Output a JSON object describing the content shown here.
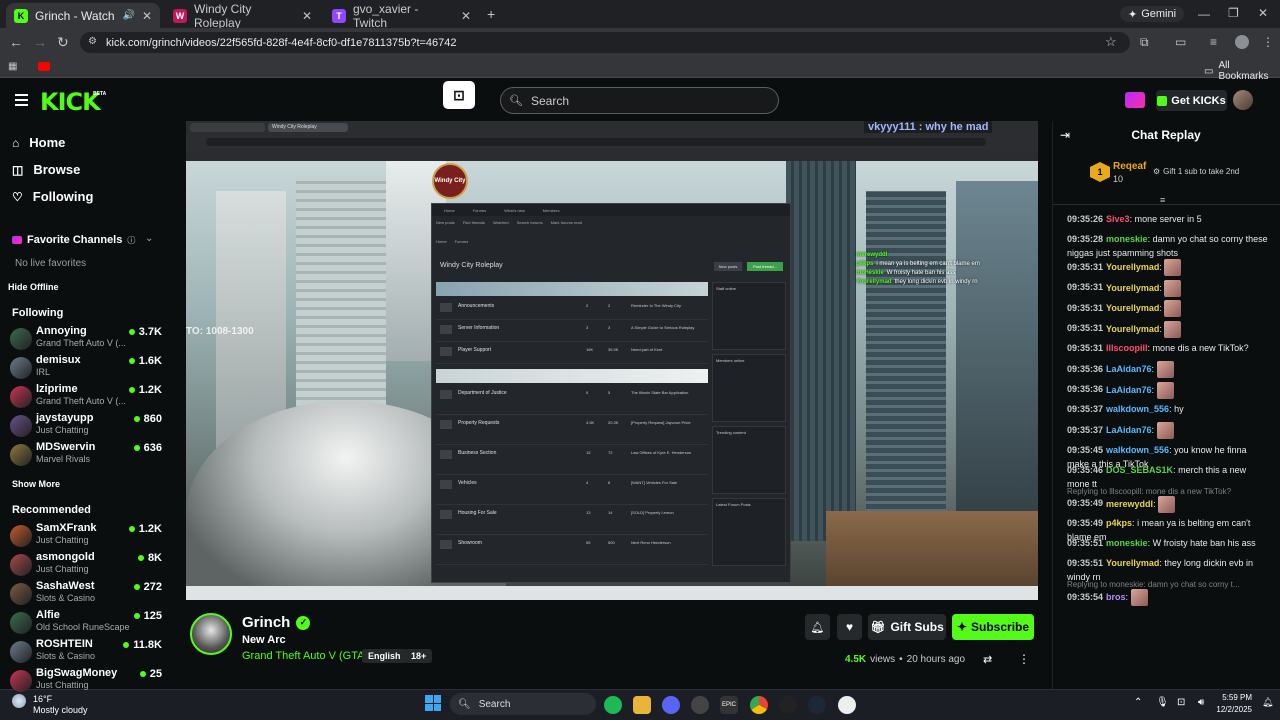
{
  "browser": {
    "tabs": [
      {
        "title": "Grinch - Watch the VOD on",
        "active": true
      },
      {
        "title": "Windy City Roleplay",
        "active": false
      },
      {
        "title": "gvo_xavier - Twitch",
        "active": false
      }
    ],
    "gemini_label": "Gemini",
    "url": "kick.com/grinch/videos/22f565fd-828f-4e4f-8cf0-df1e7811375b?t=46742",
    "all_bookmarks": "All Bookmarks"
  },
  "header": {
    "logo": "KICK",
    "logo_beta": "BETA",
    "search_placeholder": "Search",
    "get_kicks": "Get KICKs"
  },
  "sidebar": {
    "nav": [
      {
        "label": "Home",
        "icon": "home-icon"
      },
      {
        "label": "Browse",
        "icon": "compass-icon"
      },
      {
        "label": "Following",
        "icon": "heart-icon"
      }
    ],
    "favorite_title": "Favorite Channels",
    "no_favorites": "No live favorites",
    "hide_offline": "Hide Offline",
    "following_title": "Following",
    "following": [
      {
        "name": "Annoying",
        "game": "Grand Theft Auto V (...",
        "viewers": "3.7K"
      },
      {
        "name": "demisux",
        "game": "IRL",
        "viewers": "1.6K"
      },
      {
        "name": "lziprime",
        "game": "Grand Theft Auto V (...",
        "viewers": "1.2K"
      },
      {
        "name": "jaystayupp",
        "game": "Just Chatting",
        "viewers": "860"
      },
      {
        "name": "MDSwervin",
        "game": "Marvel Rivals",
        "viewers": "636"
      }
    ],
    "show_more": "Show More",
    "recommended_title": "Recommended",
    "recommended": [
      {
        "name": "SamXFrank",
        "game": "Just Chatting",
        "viewers": "1.2K"
      },
      {
        "name": "asmongold",
        "game": "Just Chatting",
        "viewers": "8K"
      },
      {
        "name": "SashaWest",
        "game": "Slots & Casino",
        "viewers": "272"
      },
      {
        "name": "Alfie",
        "game": "Old School RuneScape",
        "viewers": "125"
      },
      {
        "name": "ROSHTEIN",
        "game": "Slots & Casino",
        "viewers": "11.8K"
      },
      {
        "name": "BigSwagMoney",
        "game": "Just Chatting",
        "viewers": "25"
      }
    ]
  },
  "video": {
    "overlay_chat": "vkyyy111 : why he mad",
    "streamer_overlay": "TO: 1008-1300",
    "page_title": "Windy City Roleplay",
    "site_name": "Windy City",
    "tabs": [
      "Home",
      "Forums",
      "What's new",
      "Members"
    ],
    "subnav": [
      "New posts",
      "Find threads",
      "Watched",
      "Search forums",
      "Mark forums read"
    ],
    "breadcrumb": [
      "Home",
      "Forums"
    ],
    "buttons": [
      "New posts",
      "Post thread..."
    ],
    "side_panels": [
      "Staff online",
      "Members online",
      "Trending content",
      "Latest Forum Posts"
    ],
    "forum_rows_1": [
      {
        "title": "Announcements",
        "threads": "2",
        "messages": "2",
        "latest": "Reminder In The Windy City"
      },
      {
        "title": "Server Information",
        "threads": "3",
        "messages": "3",
        "latest": "A Simple Guide to Serious Roleplay"
      },
      {
        "title": "Player Support",
        "threads": "16K",
        "messages": "36.9K",
        "latest": "Need part of Kent"
      }
    ],
    "forum_rows_2": [
      {
        "title": "Department of Justice",
        "threads": "5",
        "messages": "5",
        "latest": "The Illinois State Bar Application"
      },
      {
        "title": "Property Requests",
        "threads": "4.5K",
        "messages": "20.3K",
        "latest": "[Property Request] Jayvoon Price"
      },
      {
        "title": "Business Section",
        "threads": "15",
        "messages": "72",
        "latest": "Law Offices of Kyre E. Henderson"
      },
      {
        "title": "Vehicles",
        "threads": "4",
        "messages": "8",
        "latest": "[WANT] Vehicles For Sale"
      },
      {
        "title": "Housing For Sale",
        "threads": "13",
        "messages": "14",
        "latest": "[SOLD] Property Lemon"
      },
      {
        "title": "Showroom",
        "threads": "55",
        "messages": "500",
        "latest": "Next Reno Henderson"
      }
    ],
    "overlay_chat_lines": [
      {
        "user": "merewyddl",
        "text": ""
      },
      {
        "user": "p4kps",
        "text": "i mean ya is belting em can't blame em"
      },
      {
        "user": "moneskie",
        "text": "W froisty hate ban his ass"
      },
      {
        "user": "Yourellymad",
        "text": "they long dickin evb in windy rn"
      }
    ]
  },
  "stream_info": {
    "channel": "Grinch",
    "title": "New Arc",
    "category": "Grand Theft Auto V (GTA)",
    "tags": [
      "English",
      "18+"
    ],
    "gift_subs": "Gift Subs",
    "subscribe": "Subscribe",
    "views_count": "4.5K",
    "views_label": "views",
    "time_ago": "20 hours ago"
  },
  "chat": {
    "title": "Chat Replay",
    "pinned_user": "Reqeaf",
    "pinned_count": "10",
    "pinned_msg": "Gift 1 sub to take 2nd",
    "messages": [
      {
        "time": "09:35:26",
        "user": "Sive3",
        "color": "#ff4d6d",
        "text": "mone server in 5"
      },
      {
        "time": "09:35:28",
        "user": "moneskie",
        "color": "#5bd24f",
        "text": "damn yo chat so corny these niggas just spamming shots"
      },
      {
        "time": "09:35:31",
        "user": "Yourellymad",
        "color": "#e8d44d",
        "text": ""
      },
      {
        "time": "09:35:31",
        "user": "Yourellymad",
        "color": "#e8d44d",
        "text": ""
      },
      {
        "time": "09:35:31",
        "user": "Yourellymad",
        "color": "#e8d44d",
        "text": ""
      },
      {
        "time": "09:35:31",
        "user": "Yourellymad",
        "color": "#e8d44d",
        "text": ""
      },
      {
        "time": "09:35:31",
        "user": "lllscoopill",
        "color": "#ff4d6d",
        "text": "mone dis a new TikTok?"
      },
      {
        "time": "09:35:36",
        "user": "LaAidan76",
        "color": "#5bb8ff",
        "text": ""
      },
      {
        "time": "09:35:36",
        "user": "LaAidan76",
        "color": "#5bb8ff",
        "text": ""
      },
      {
        "time": "09:35:37",
        "user": "walkdown_556",
        "color": "#5bb8ff",
        "text": "hy"
      },
      {
        "time": "09:35:37",
        "user": "LaAidan76",
        "color": "#5bb8ff",
        "text": ""
      },
      {
        "time": "09:35:45",
        "user": "walkdown_556",
        "color": "#5bb8ff",
        "text": "you know he finna make a this a TikTok"
      },
      {
        "time": "09:35:46",
        "user": "DOS_SEBAS1K",
        "color": "#5bd24f",
        "text": "merch this a new mone tt"
      },
      {
        "reply": "Replying to lllscoopill: mone dis a new TikTok?"
      },
      {
        "time": "09:35:49",
        "user": "merewyddl",
        "color": "#e8d44d",
        "text": ""
      },
      {
        "time": "09:35:49",
        "user": "p4kps",
        "color": "#e8d44d",
        "text": "i mean ya is belting em can't blame em"
      },
      {
        "time": "09:35:51",
        "user": "moneskie",
        "color": "#5bd24f",
        "text": "W froisty hate ban his ass"
      },
      {
        "time": "09:35:51",
        "user": "Yourellymad",
        "color": "#e8d44d",
        "text": "they long dickin evb in windy rn"
      },
      {
        "reply": "Replying to moneskie: damn yo chat so corny t..."
      },
      {
        "time": "09:35:54",
        "user": "bros",
        "color": "#b48cff",
        "text": ""
      }
    ]
  },
  "taskbar": {
    "search": "Search",
    "weather_temp": "16°F",
    "weather_desc": "Mostly cloudy",
    "time": "5:59 PM",
    "date": "12/2/2025"
  },
  "colors": {
    "kick_green": "#53fc18",
    "verified": "#53fc18",
    "chat_bg": "#0b0e0f"
  }
}
